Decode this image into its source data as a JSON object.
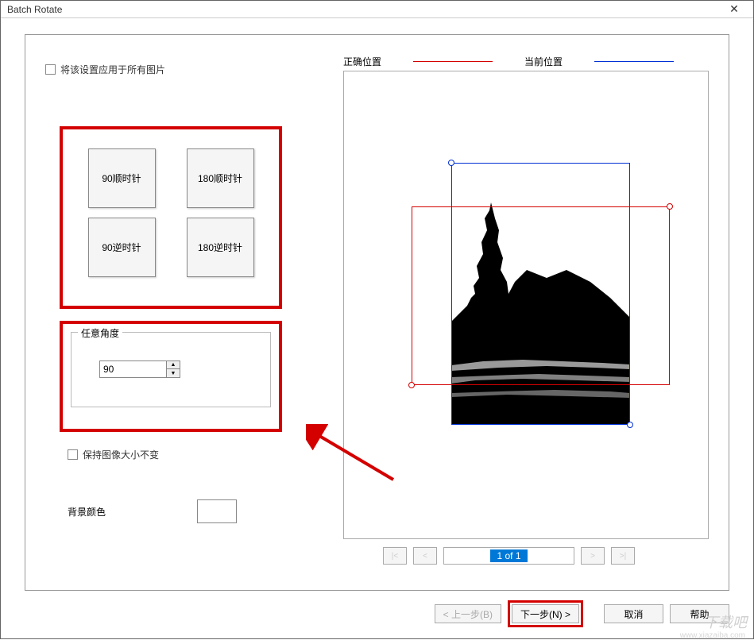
{
  "titlebar": {
    "title": "Batch Rotate"
  },
  "left": {
    "apply_all_label": "将该设置应用于所有图片",
    "rot_90_cw": "90顺时针",
    "rot_180_cw": "180顺时针",
    "rot_90_ccw": "90逆时针",
    "rot_180_ccw": "180逆时针",
    "angle_group_title": "任意角度",
    "angle_value": "90",
    "keep_size_label": "保持图像大小不变",
    "bgcolor_label": "背景颜色"
  },
  "legend": {
    "correct_label": "正确位置",
    "current_label": "当前位置",
    "correct_color": "#d40000",
    "current_color": "#0030d4"
  },
  "pager": {
    "first": "|<",
    "prev": "<",
    "text": "1 of 1",
    "next": ">",
    "last": ">|"
  },
  "buttons": {
    "prev": "< 上一步(B)",
    "next": "下一步(N) >",
    "cancel": "取消",
    "help": "帮助"
  },
  "watermark": {
    "main": "下载吧",
    "sub": "www.xiazaiba.com"
  },
  "colors": {
    "highlight": "#d40000"
  }
}
